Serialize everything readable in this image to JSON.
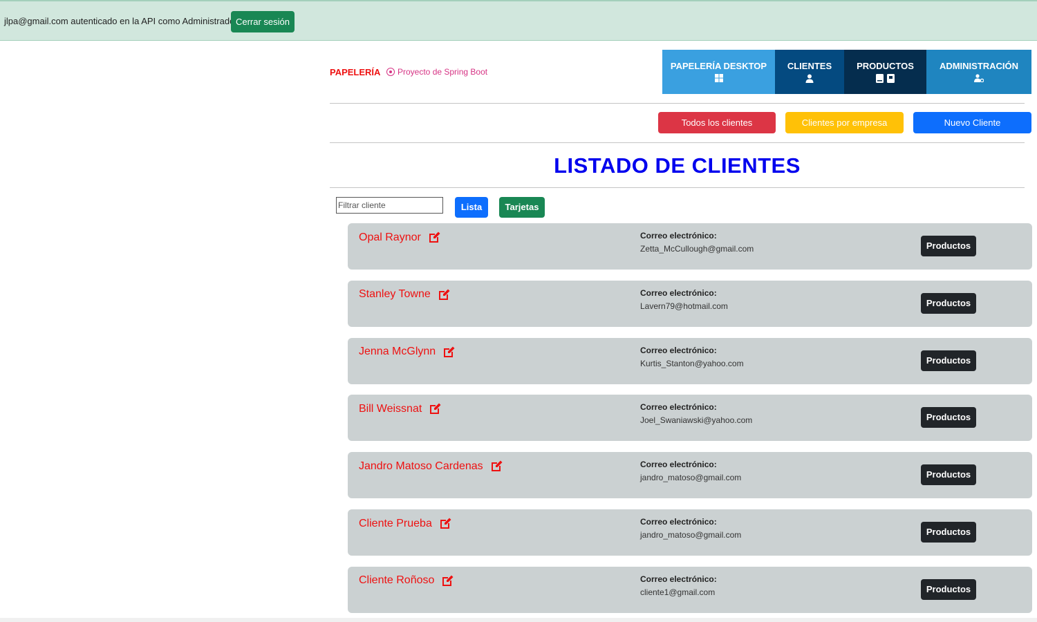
{
  "topbar": {
    "auth_text": "jlpa@gmail.com autenticado en la API como Administrador",
    "logout_label": "Cerrar sesión"
  },
  "header": {
    "brand": "PAPELERÍA",
    "tagline": "Proyecto de Spring Boot",
    "tabs": [
      {
        "label": "PAPELERÍA DESKTOP",
        "icon": "windows-icon"
      },
      {
        "label": "CLIENTES",
        "icon": "user-icon"
      },
      {
        "label": "PRODUCTOS",
        "icon": "books-icon"
      },
      {
        "label": "ADMINISTRACIÓN",
        "icon": "user-gear-icon"
      }
    ]
  },
  "actions": {
    "all_clients": "Todos los clientes",
    "by_company": "Clientes por empresa",
    "new_client": "Nuevo Cliente"
  },
  "main": {
    "title": "LISTADO DE CLIENTES"
  },
  "filter": {
    "placeholder": "Filtrar cliente",
    "list_label": "Lista",
    "cards_label": "Tarjetas"
  },
  "clients": [
    {
      "name": "Opal Raynor",
      "email_label": "Correo electrónico:",
      "email": "Zetta_McCullough@gmail.com",
      "button": "Productos"
    },
    {
      "name": "Stanley Towne",
      "email_label": "Correo electrónico:",
      "email": "Lavern79@hotmail.com",
      "button": "Productos"
    },
    {
      "name": "Jenna McGlynn",
      "email_label": "Correo electrónico:",
      "email": "Kurtis_Stanton@yahoo.com",
      "button": "Productos"
    },
    {
      "name": "Bill Weissnat",
      "email_label": "Correo electrónico:",
      "email": "Joel_Swaniawski@yahoo.com",
      "button": "Productos"
    },
    {
      "name": "Jandro Matoso Cardenas",
      "email_label": "Correo electrónico:",
      "email": "jandro_matoso@gmail.com",
      "button": "Productos"
    },
    {
      "name": "Cliente Prueba",
      "email_label": "Correo electrónico:",
      "email": "jandro_matoso@gmail.com",
      "button": "Productos"
    },
    {
      "name": "Cliente Roñoso",
      "email_label": "Correo electrónico:",
      "email": "cliente1@gmail.com",
      "button": "Productos"
    }
  ],
  "colors": {
    "name_red": "#ee1111",
    "title_blue": "#0000ee",
    "card_bg": "#cbd1d2"
  }
}
